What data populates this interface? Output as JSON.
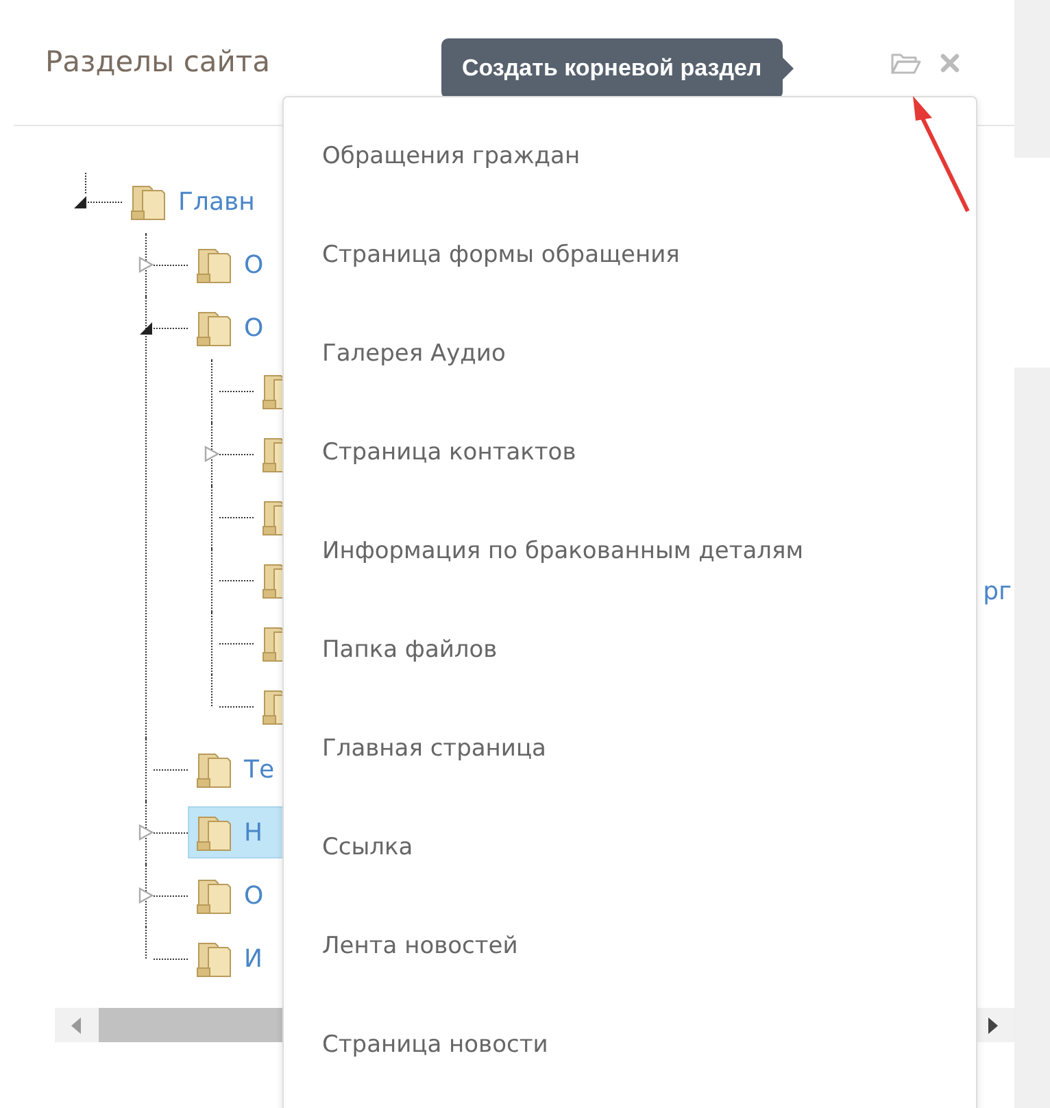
{
  "panel": {
    "title": "Разделы сайта",
    "actions": [
      {
        "kind": "create-root"
      },
      {
        "kind": "close"
      }
    ]
  },
  "tooltip": {
    "text": "Создать корневой раздел"
  },
  "annotation_arrow": true,
  "tree": [
    {
      "kind": "branch",
      "expanded": true,
      "selected": false,
      "label": "Главн",
      "children": [
        {
          "kind": "branch",
          "expanded": false,
          "selected": false,
          "label": "О"
        },
        {
          "kind": "branch",
          "expanded": true,
          "selected": false,
          "label": "О",
          "children": [
            {
              "kind": "leaf",
              "selected": false
            },
            {
              "kind": "branch",
              "expanded": false,
              "selected": false
            },
            {
              "kind": "leaf",
              "selected": false
            },
            {
              "kind": "leaf",
              "selected": false,
              "tail_label": "рг"
            },
            {
              "kind": "leaf",
              "selected": false
            },
            {
              "kind": "leaf",
              "selected": false
            }
          ]
        },
        {
          "kind": "leaf",
          "selected": false,
          "label": "Те"
        },
        {
          "kind": "branch",
          "expanded": false,
          "selected": true,
          "label": "Н"
        },
        {
          "kind": "branch",
          "expanded": false,
          "selected": false,
          "label": "О"
        },
        {
          "kind": "leaf",
          "selected": false,
          "label": "И"
        }
      ]
    }
  ],
  "menu": {
    "items": [
      {
        "label": "Обращения граждан"
      },
      {
        "label": "Страница формы обращения"
      },
      {
        "label": "Галерея Аудио"
      },
      {
        "label": "Страница контактов"
      },
      {
        "label": "Информация по бракованным деталям"
      },
      {
        "label": "Папка файлов"
      },
      {
        "label": "Главная страница"
      },
      {
        "label": "Ссылка"
      },
      {
        "label": "Лента новостей"
      },
      {
        "label": "Страница новости"
      }
    ]
  }
}
